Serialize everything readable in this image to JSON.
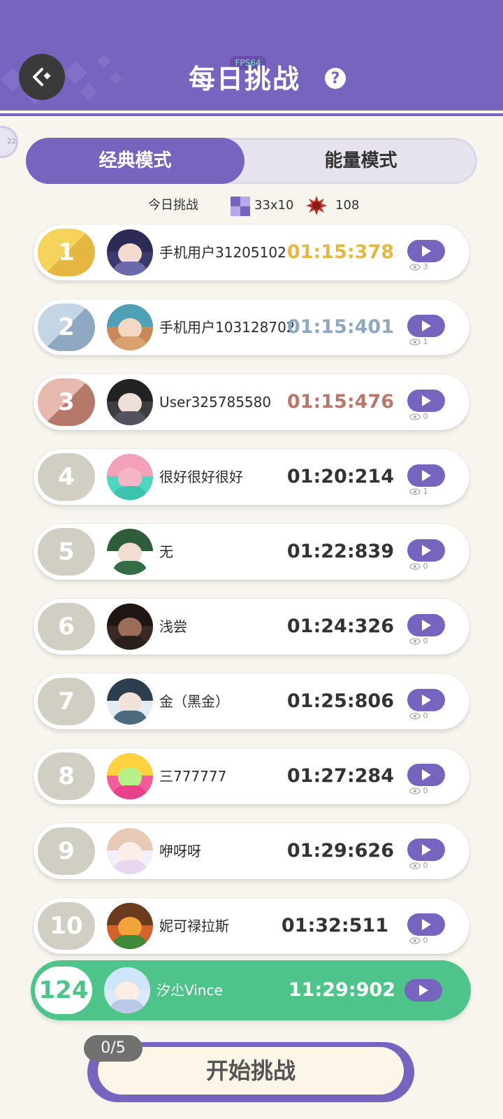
{
  "header": {
    "title": "每日挑战",
    "fps": "FPS64",
    "help_icon": "question-icon"
  },
  "side_badge": "22",
  "tabs": [
    {
      "label": "经典模式"
    },
    {
      "label": "能量模式"
    }
  ],
  "today": {
    "label": "今日挑战",
    "grid": "33x10",
    "energy": "108"
  },
  "entries": [
    {
      "rank": "1",
      "name": "手机用户31205102",
      "time": "01:15:378",
      "views": "3"
    },
    {
      "rank": "2",
      "name": "手机用户103128702",
      "time": "01:15:401",
      "views": "1"
    },
    {
      "rank": "3",
      "name": "User325785580",
      "time": "01:15:476",
      "views": "0"
    },
    {
      "rank": "4",
      "name": "很好很好很好",
      "time": "01:20:214",
      "views": "1"
    },
    {
      "rank": "5",
      "name": "无",
      "time": "01:22:839",
      "views": "0"
    },
    {
      "rank": "6",
      "name": "浅尝",
      "time": "01:24:326",
      "views": "0"
    },
    {
      "rank": "7",
      "name": "金（黑金）",
      "time": "01:25:806",
      "views": "0"
    },
    {
      "rank": "8",
      "name": "三777777",
      "time": "01:27:284",
      "views": "0"
    },
    {
      "rank": "9",
      "name": "咿呀呀",
      "time": "01:29:626",
      "views": "0"
    },
    {
      "rank": "10",
      "name": "妮可禄拉斯",
      "time": "01:32:511",
      "views": "0"
    }
  ],
  "me": {
    "rank": "124",
    "name": "汐尐Vince",
    "time": "11:29:902"
  },
  "start": {
    "label": "开始挑战",
    "attempts": "0/5"
  },
  "colors": {
    "accent": "#7764bf",
    "gold": "#e6b643",
    "silver": "#8fa8c2",
    "bronze": "#b5786a",
    "green": "#4fc48a"
  }
}
